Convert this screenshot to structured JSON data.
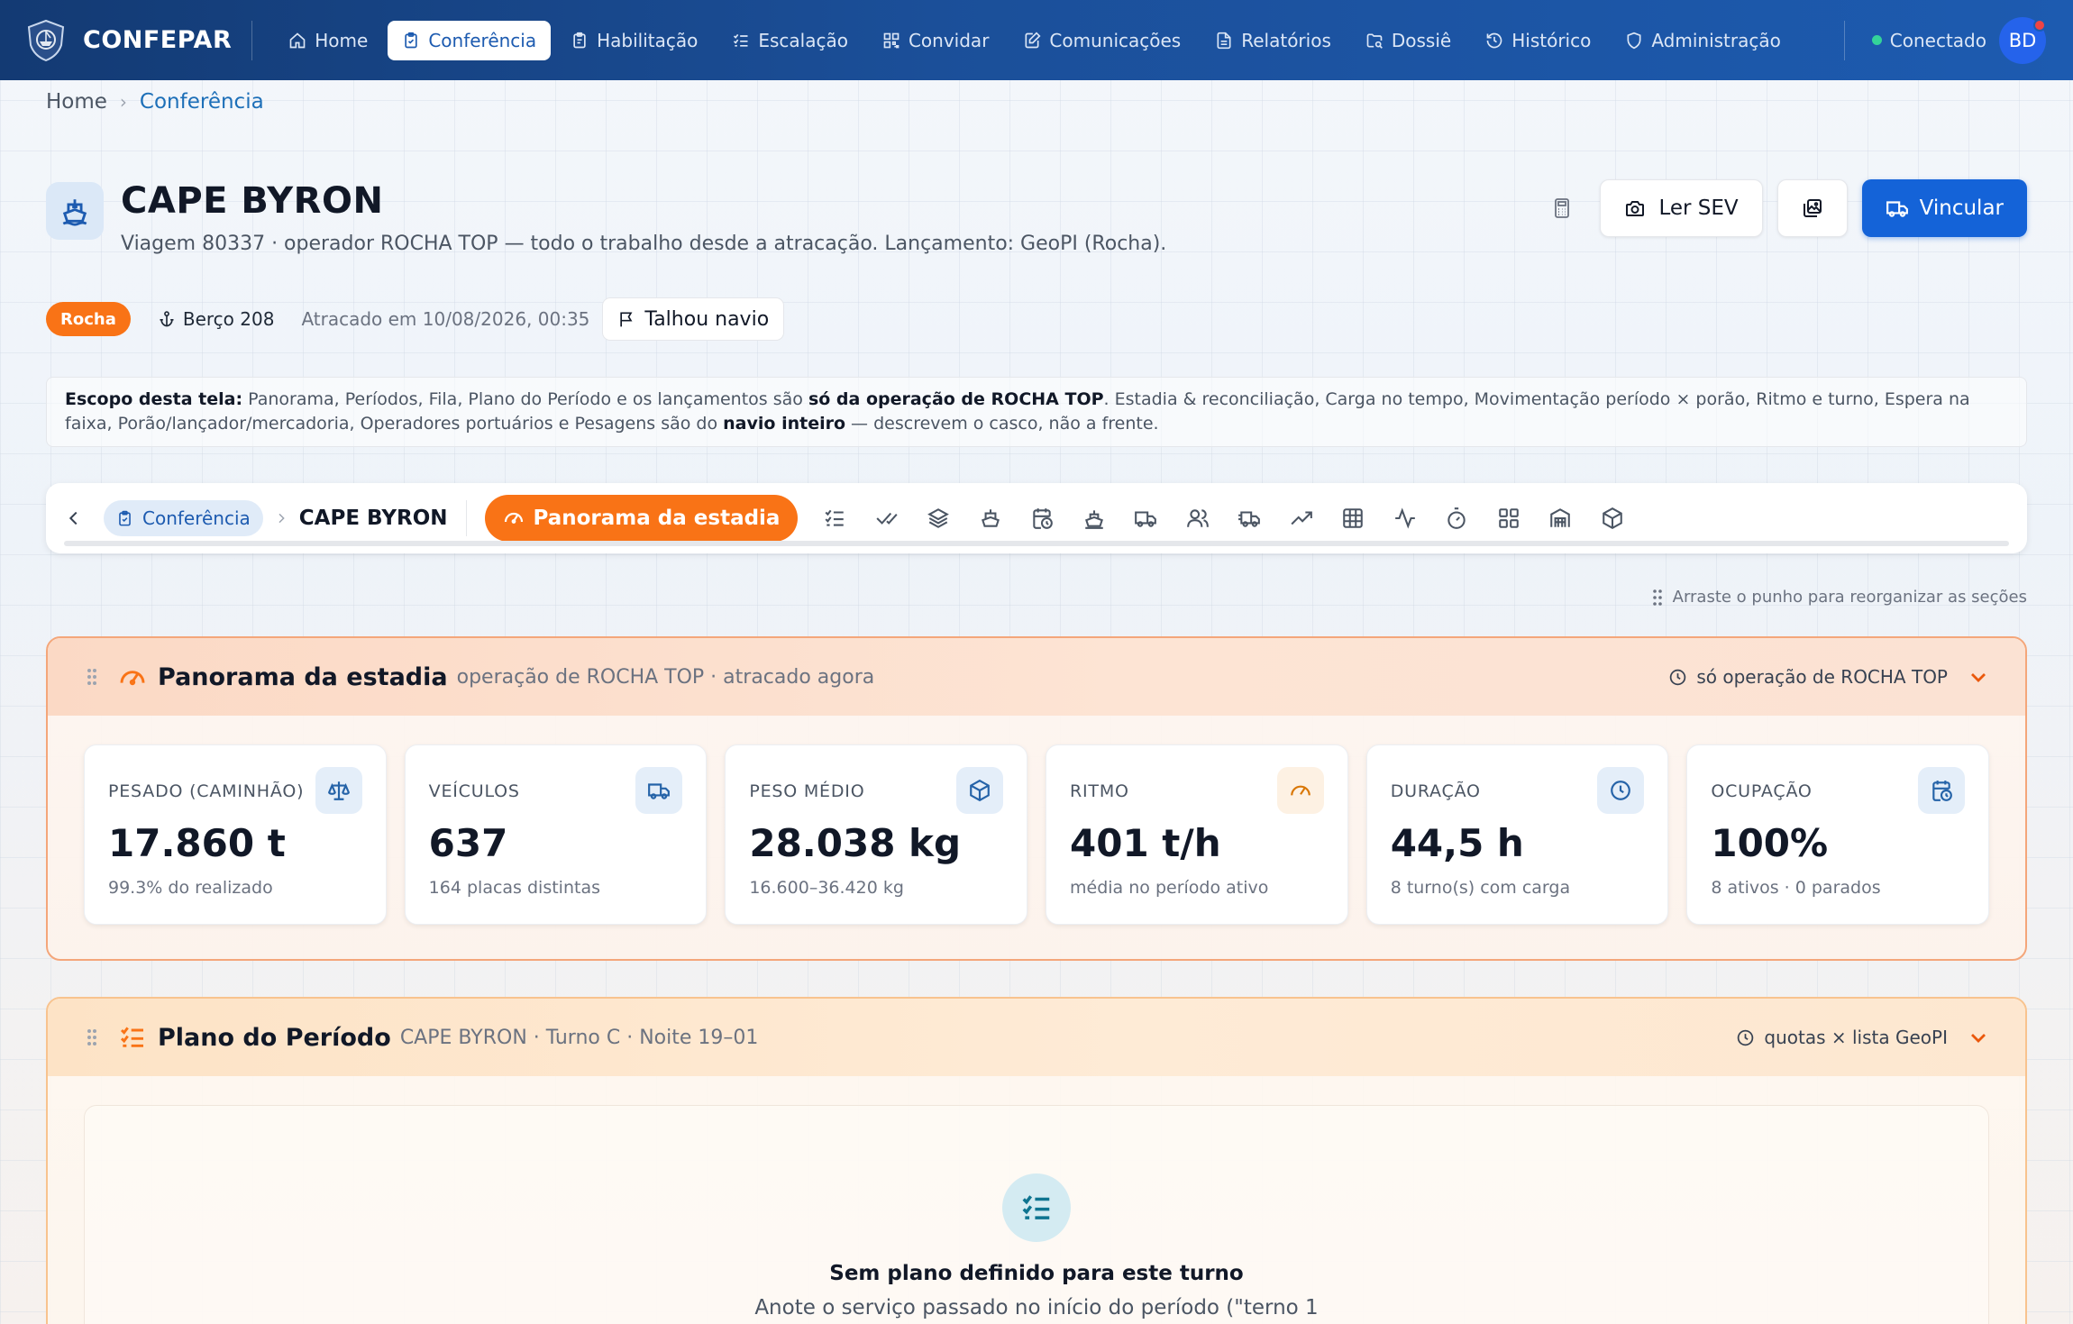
{
  "app": {
    "brand": "CONFEPAR",
    "nav": [
      {
        "label": "Home",
        "icon": "home-icon"
      },
      {
        "label": "Conferência",
        "icon": "clipboard-icon",
        "active": true
      },
      {
        "label": "Habilitação",
        "icon": "clipboard-check-icon"
      },
      {
        "label": "Escalação",
        "icon": "list-check-icon"
      },
      {
        "label": "Convidar",
        "icon": "qr-code-icon"
      },
      {
        "label": "Comunicações",
        "icon": "edit-document-icon"
      },
      {
        "label": "Relatórios",
        "icon": "report-icon"
      },
      {
        "label": "Dossiê",
        "icon": "folder-search-icon"
      },
      {
        "label": "Histórico",
        "icon": "history-icon"
      },
      {
        "label": "Administração",
        "icon": "shield-icon"
      }
    ],
    "status": "Conectado",
    "status_color": "#34d399",
    "avatar": "BD"
  },
  "breadcrumb": {
    "home": "Home",
    "current": "Conferência"
  },
  "header": {
    "title": "CAPE BYRON",
    "subtitle": "Viagem 80337 · operador ROCHA TOP — todo o trabalho desde a atracação. Lançamento: GeoPI (Rocha).",
    "actions": {
      "read_sev": "Ler SEV",
      "link": "Vincular"
    }
  },
  "meta": {
    "badge": "Rocha",
    "badge_color": "#f97316",
    "berth": "Berço 208",
    "docked": "Atracado em 10/08/2026, 00:35",
    "talhou": "Talhou navio"
  },
  "scope": {
    "lead": "Escopo desta tela:",
    "text1": " Panorama, Períodos, Fila, Plano do Período e os lançamentos são ",
    "bold1": "só da operação de ROCHA TOP",
    "text2": ". Estadia & reconciliação, Carga no tempo, Movimentação período × porão, Ritmo e turno, Espera na faixa, Porão/lançador/mercadoria, Operadores portuários e Pesagens são do ",
    "bold2": "navio inteiro",
    "text3": " — descrevem o casco, não a frente."
  },
  "toolbar": {
    "pill": "Conferência",
    "ship": "CAPE BYRON",
    "active": "Panorama da estadia",
    "icons": [
      "list-check-icon",
      "check-double-icon",
      "layers-icon",
      "ship-icon",
      "calendar-clock-icon",
      "ship-wheel-icon",
      "truck-icon",
      "users-icon",
      "truck-fast-icon",
      "trending-up-icon",
      "table-grid-icon",
      "activity-icon",
      "timer-icon",
      "grid-icon",
      "warehouse-icon",
      "package-icon"
    ]
  },
  "drag_hint": "Arraste o punho para reorganizar as seções",
  "panorama": {
    "title": "Panorama da estadia",
    "subtitle": "operação de ROCHA TOP · atracado agora",
    "scope_tag": "só operação de ROCHA TOP",
    "kpis": [
      {
        "label": "PESADO (CAMINHÃO)",
        "value": "17.860 t",
        "note": "99.3% do realizado",
        "icon": "scale-icon"
      },
      {
        "label": "VEÍCULOS",
        "value": "637",
        "note": "164 placas distintas",
        "icon": "truck-icon"
      },
      {
        "label": "PESO MÉDIO",
        "value": "28.038 kg",
        "note": "16.600–36.420 kg",
        "icon": "package-icon"
      },
      {
        "label": "RITMO",
        "value": "401 t/h",
        "note": "média no período ativo",
        "icon": "gauge-icon"
      },
      {
        "label": "DURAÇÃO",
        "value": "44,5 h",
        "note": "8 turno(s) com carga",
        "icon": "clock-icon"
      },
      {
        "label": "OCUPAÇÃO",
        "value": "100%",
        "note": "8 ativos · 0 parados",
        "icon": "calendar-clock-icon"
      }
    ]
  },
  "plan": {
    "title": "Plano do Período",
    "subtitle": "CAPE BYRON · Turno C · Noite 19–01",
    "scope_tag": "quotas × lista GeoPI",
    "empty_title": "Sem plano definido para este turno",
    "empty_text": "Anote o serviço passado no início do período (\"terno 1"
  }
}
